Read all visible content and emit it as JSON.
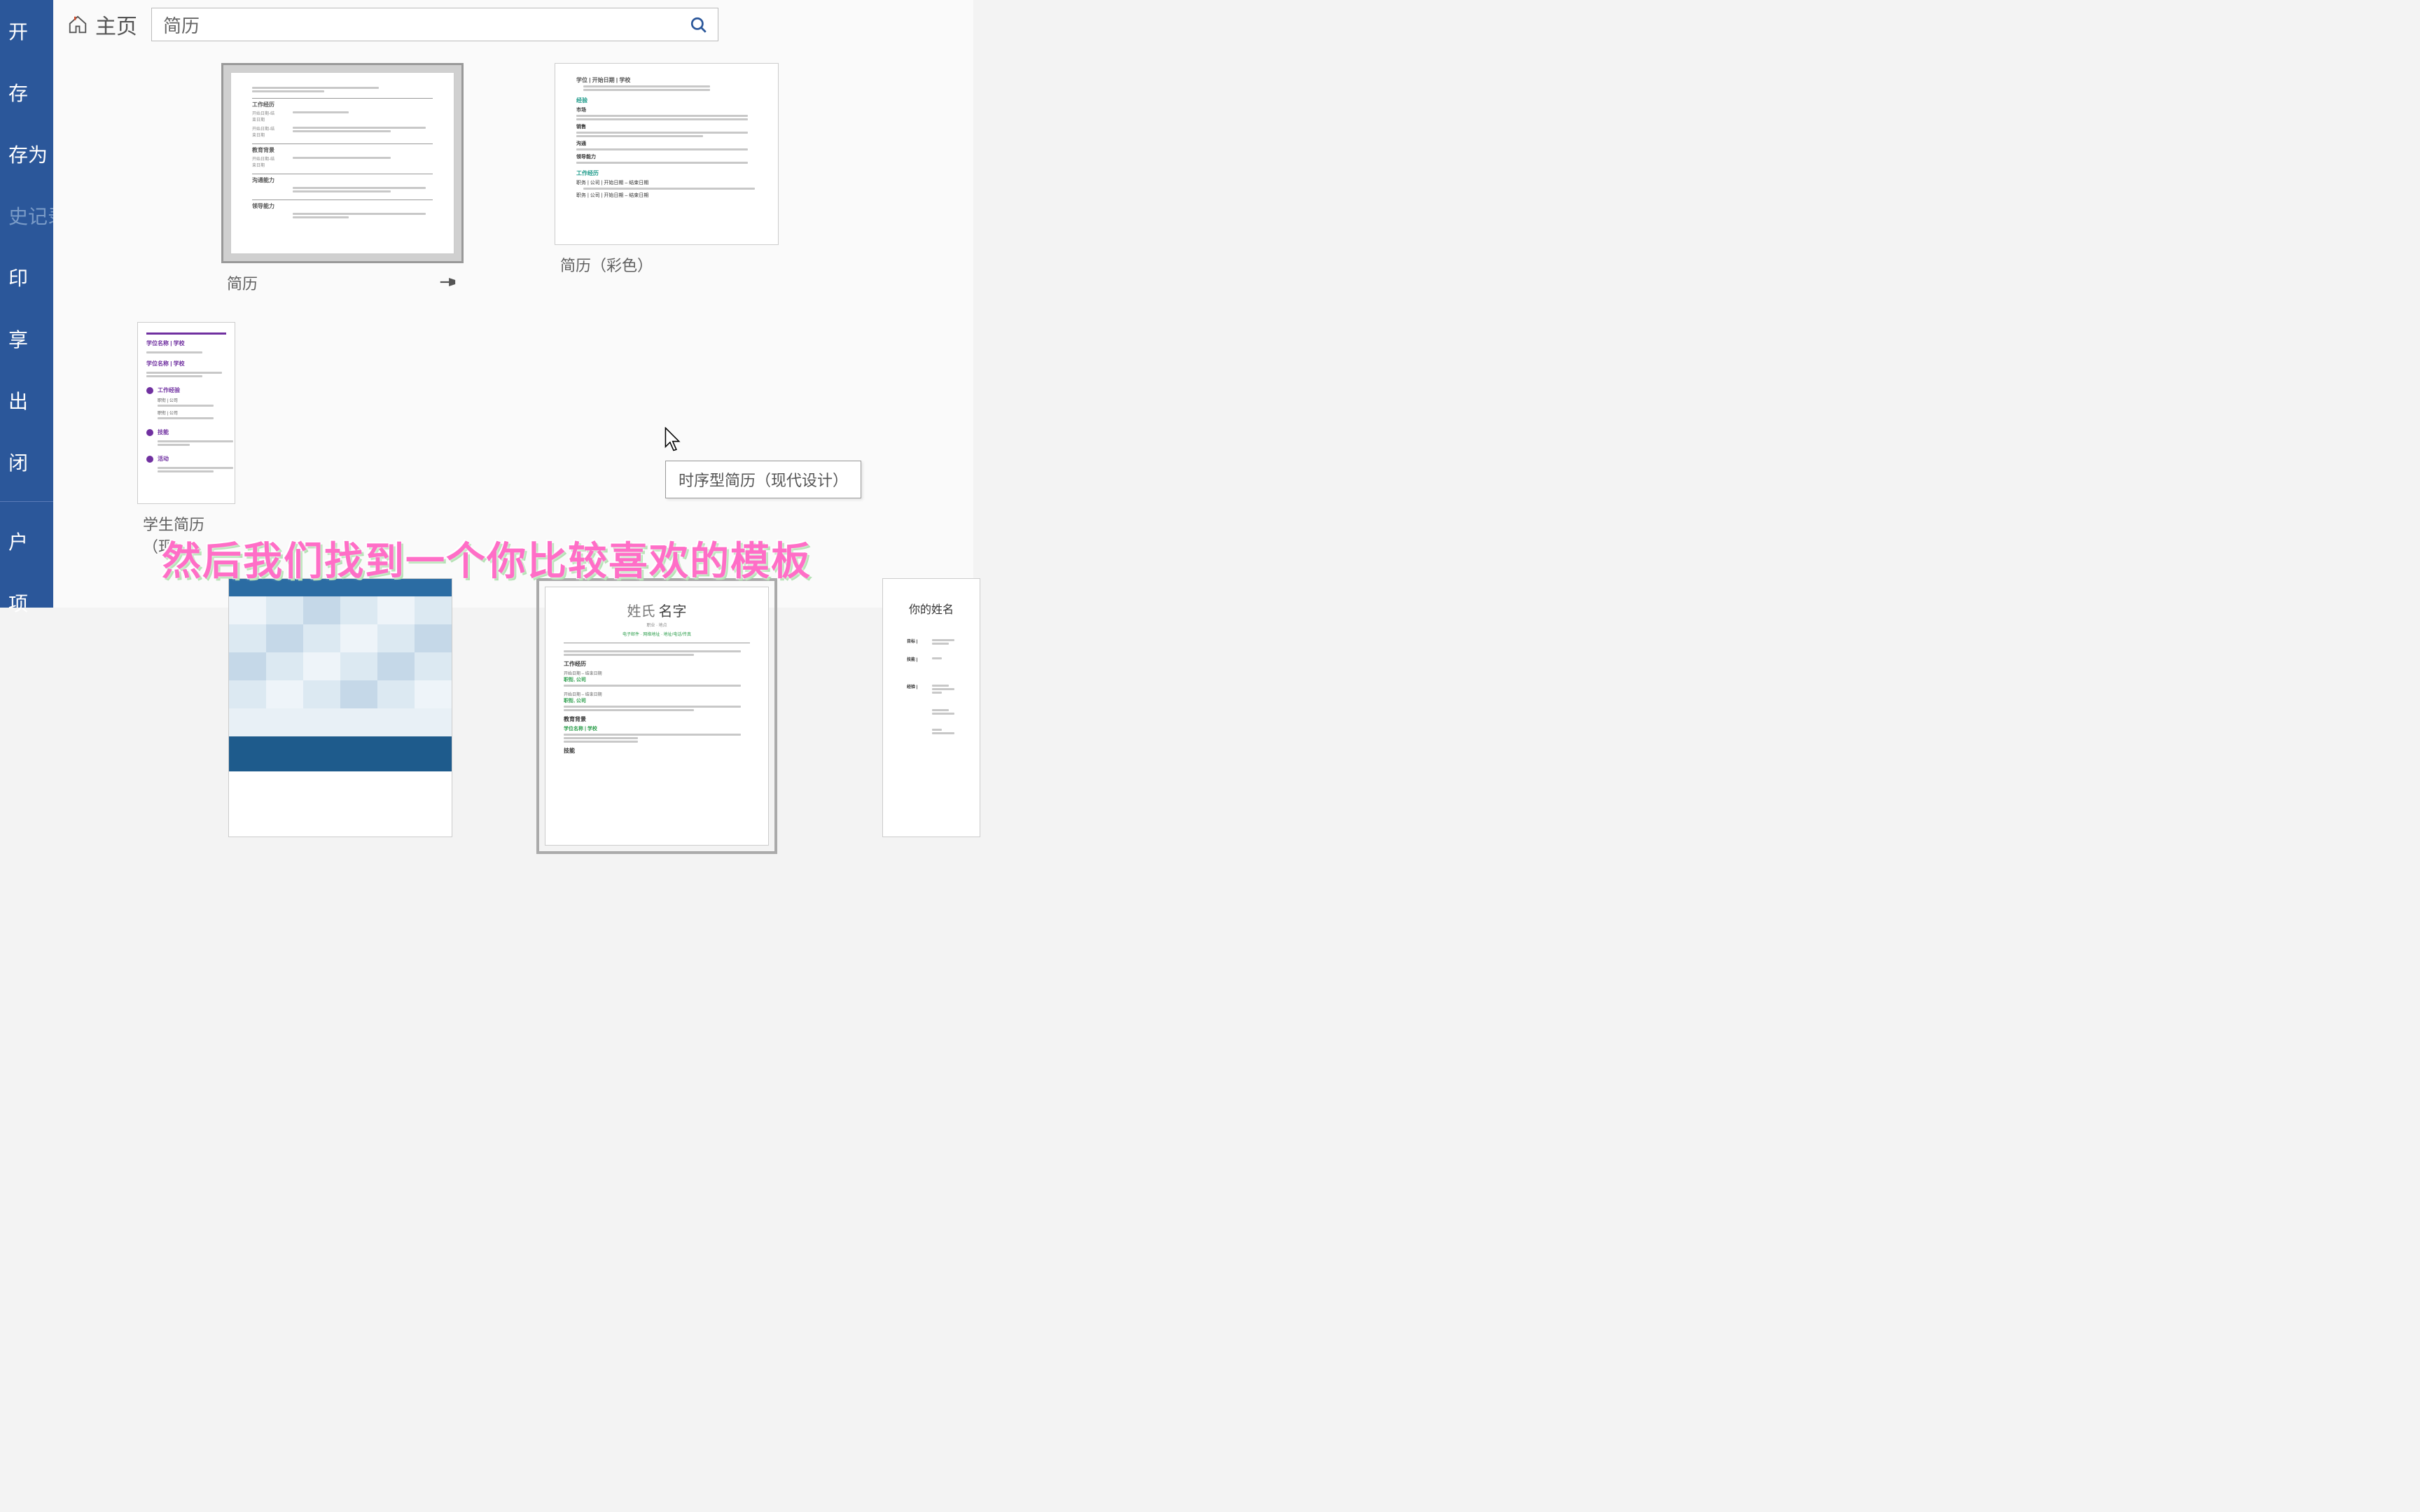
{
  "sidebar": {
    "items": [
      {
        "label": "开"
      },
      {
        "label": "存"
      },
      {
        "label": "存为"
      },
      {
        "label": "史记录",
        "dimmed": true
      },
      {
        "label": "印"
      },
      {
        "label": "享"
      },
      {
        "label": "出"
      },
      {
        "label": "闭"
      },
      {
        "label": "户"
      },
      {
        "label": "项"
      }
    ]
  },
  "topbar": {
    "home_label": "主页",
    "search_value": "简历"
  },
  "templates": {
    "row1": [
      {
        "title": "简历",
        "selected": true,
        "pinned": true
      },
      {
        "title": "简历（彩色）"
      },
      {
        "title": "学生简历（现"
      }
    ],
    "row2": [
      {
        "title": ""
      },
      {
        "title": "",
        "hovered": true,
        "name_surname": "姓氏",
        "name_given": "名字",
        "contact": "电子邮件 · 网络地址 · 地址/电话/传真"
      },
      {
        "title": "",
        "your_name": "你的姓名"
      }
    ]
  },
  "tooltip": {
    "text": "时序型简历（现代设计）"
  },
  "subtitle": {
    "text": "然后我们找到一个你比较喜欢的模板"
  },
  "thumb_labels": {
    "work_exp": "工作经历",
    "edu": "教育背景",
    "skills": "技能",
    "activities": "活动",
    "job_title": "职衔 | 公司",
    "date_range": "开始日期 – 结束日期",
    "degree": "学位名称 | 学校"
  }
}
